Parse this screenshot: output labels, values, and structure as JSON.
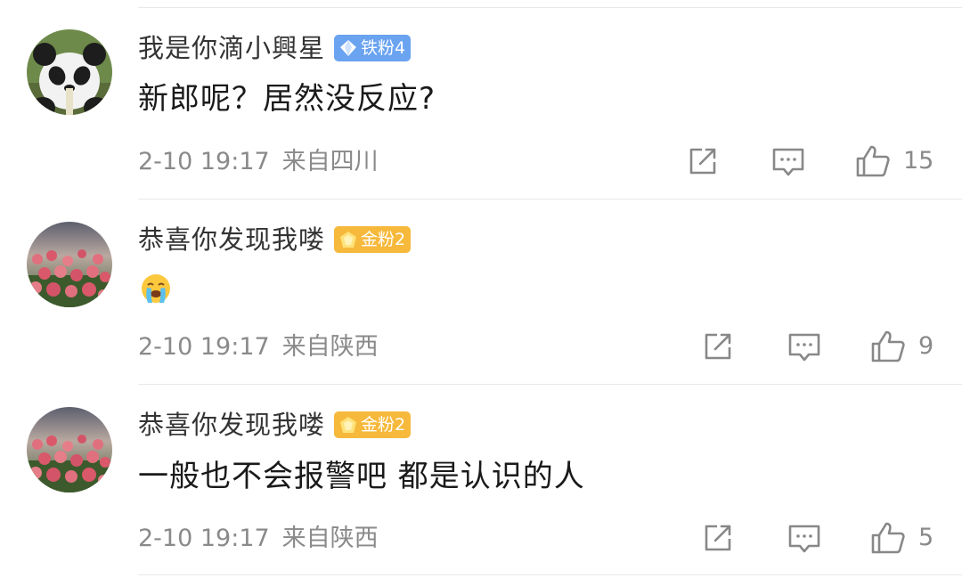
{
  "comments": [
    {
      "avatar_icon": "panda-avatar",
      "username": "我是你滴小興星",
      "badge": {
        "label": "铁粉4",
        "icon": "diamond-icon",
        "color": "#6aa3f0"
      },
      "text": "新郎呢？居然没反应?",
      "time": "2-10 19:17",
      "location": "来自四川",
      "likes": "15"
    },
    {
      "avatar_icon": "tulip-field-avatar",
      "username": "恭喜你发现我喽",
      "badge": {
        "label": "金粉2",
        "icon": "gold-gem-icon",
        "color": "#f6b93b"
      },
      "text": "",
      "emoji": "crying-face-emoji",
      "time": "2-10 19:17",
      "location": "来自陕西",
      "likes": "9"
    },
    {
      "avatar_icon": "tulip-field-avatar",
      "username": "恭喜你发现我喽",
      "badge": {
        "label": "金粉2",
        "icon": "gold-gem-icon",
        "color": "#f6b93b"
      },
      "text": "一般也不会报警吧 都是认识的人",
      "time": "2-10 19:17",
      "location": "来自陕西",
      "likes": "5"
    }
  ]
}
